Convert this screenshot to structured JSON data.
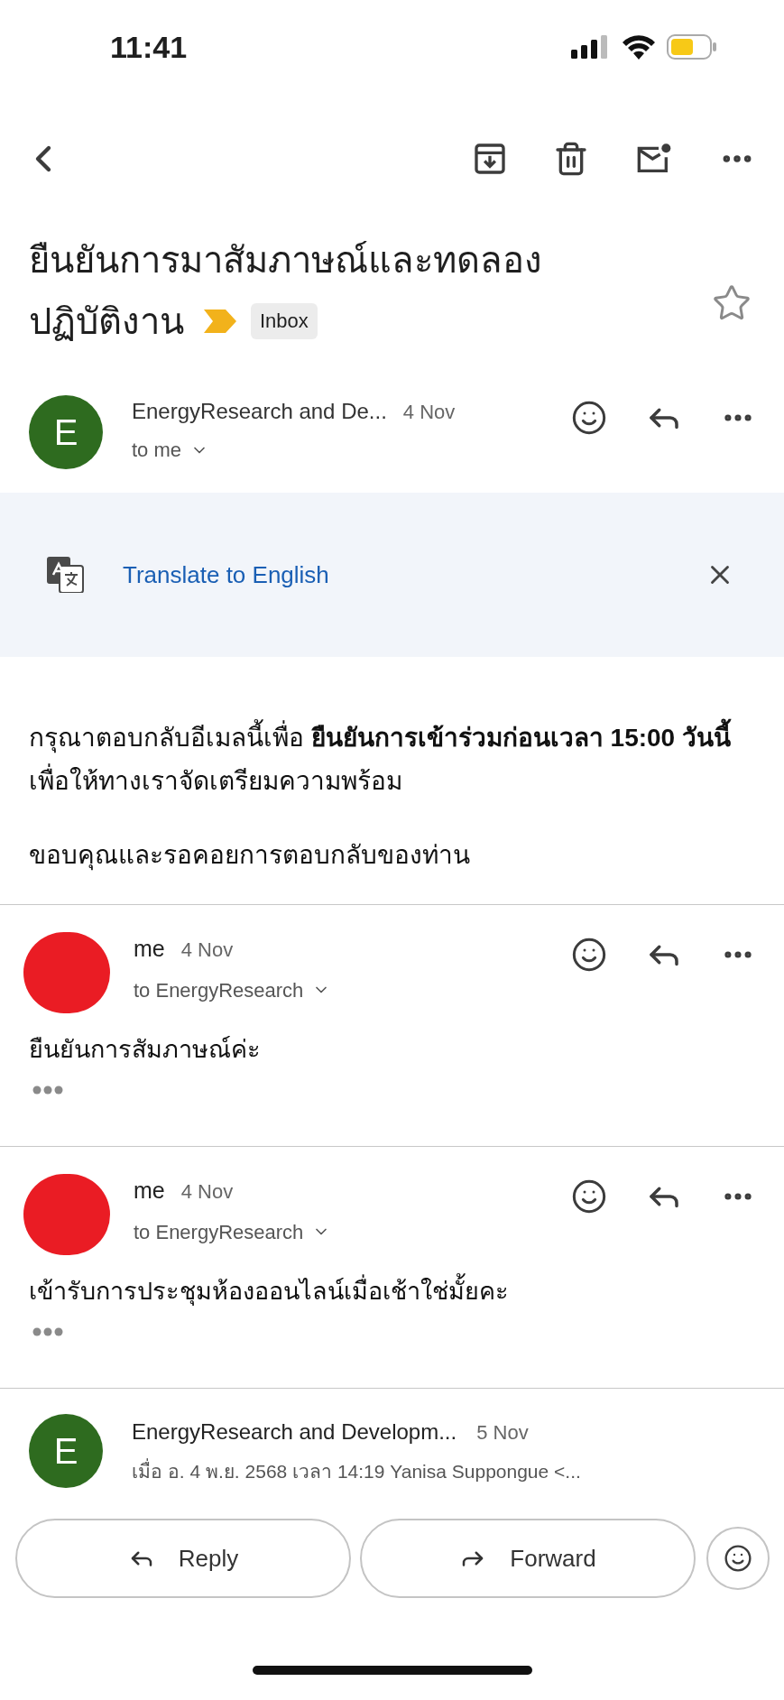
{
  "status_bar": {
    "time": "11:41"
  },
  "subject": {
    "title_lines": [
      "ยืนยันการมาสัมภาษณ์และทดลอง",
      "ปฏิบัติงาน"
    ],
    "label": "Inbox",
    "important": true,
    "starred": false
  },
  "translate_banner": {
    "link": "Translate to English"
  },
  "messages": [
    {
      "kind": "expanded",
      "avatar": {
        "kind": "letter",
        "letter": "E",
        "color": "#2e6b1f"
      },
      "sender": "EnergyResearch and De...",
      "date": "4 Nov",
      "recipient": "to me",
      "body": [
        "กรุณาตอบกลับอีเมลนี้เพื่อ **ยืนยันการเข้าร่วมก่อนเวลา 15:00 วันนี้** เพื่อให้ทางเราจัดเตรียมความพร้อม",
        "ขอบคุณและรอคอยการตอบกลับของท่าน"
      ]
    },
    {
      "kind": "reply",
      "avatar": {
        "kind": "redacted",
        "color": "#ea1c24"
      },
      "sender": "me",
      "date": "4 Nov",
      "recipient": "to EnergyResearch",
      "body": [
        "ยืนยันการสัมภาษณ์ค่ะ"
      ]
    },
    {
      "kind": "reply",
      "avatar": {
        "kind": "redacted",
        "color": "#ea1c24"
      },
      "sender": "me",
      "date": "4 Nov",
      "recipient": "to EnergyResearch",
      "body": [
        "เข้ารับการประชุมห้องออนไลน์เมื่อเช้าใช่มั้ยคะ"
      ]
    },
    {
      "kind": "collapsed",
      "avatar": {
        "kind": "letter",
        "letter": "E",
        "color": "#2e6b1f"
      },
      "sender": "EnergyResearch and Developm...",
      "date": "5 Nov",
      "preview": "เมื่อ อ. 4 พ.ย. 2568 เวลา 14:19 Yanisa Suppongue <..."
    }
  ],
  "actions": [
    {
      "kind": "reply",
      "label": "Reply"
    },
    {
      "kind": "forward",
      "label": "Forward"
    },
    {
      "kind": "emoji"
    }
  ]
}
